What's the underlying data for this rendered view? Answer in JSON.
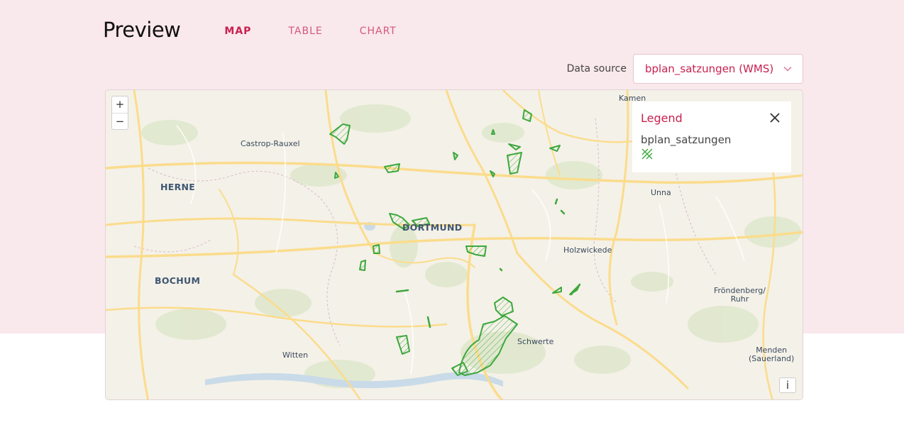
{
  "header": {
    "title": "Preview",
    "tabs": [
      {
        "label": "MAP",
        "active": true
      },
      {
        "label": "TABLE",
        "active": false
      },
      {
        "label": "CHART",
        "active": false
      }
    ]
  },
  "datasource": {
    "label": "Data source",
    "value": "bplan_satzungen (WMS)",
    "icon": "chevron-down-icon"
  },
  "map": {
    "zoom_in": "+",
    "zoom_out": "−",
    "info": "i",
    "places": {
      "kamen": "Kamen",
      "castrop": "Castrop-Rauxel",
      "herne": "HERNE",
      "dortmund": "DORTMUND",
      "unna": "Unna",
      "holzwickede": "Holzwickede",
      "bochum": "BOCHUM",
      "froendenberg_1": "Fröndenberg/",
      "froendenberg_2": "Ruhr",
      "schwerte": "Schwerte",
      "witten": "Witten",
      "menden_1": "Menden",
      "menden_2": "(Sauerland)"
    }
  },
  "legend": {
    "title": "Legend",
    "layer_name": "bplan_satzungen",
    "close_icon": "close-icon",
    "symbol_icon": "hatched-polygon-icon"
  },
  "colors": {
    "accent": "#c8214f",
    "tab_inactive": "#d4597a",
    "band": "#f9e8ec",
    "map_bg": "#f4f1e8",
    "road": "#fbdc8c",
    "feature": "#3da83d"
  }
}
